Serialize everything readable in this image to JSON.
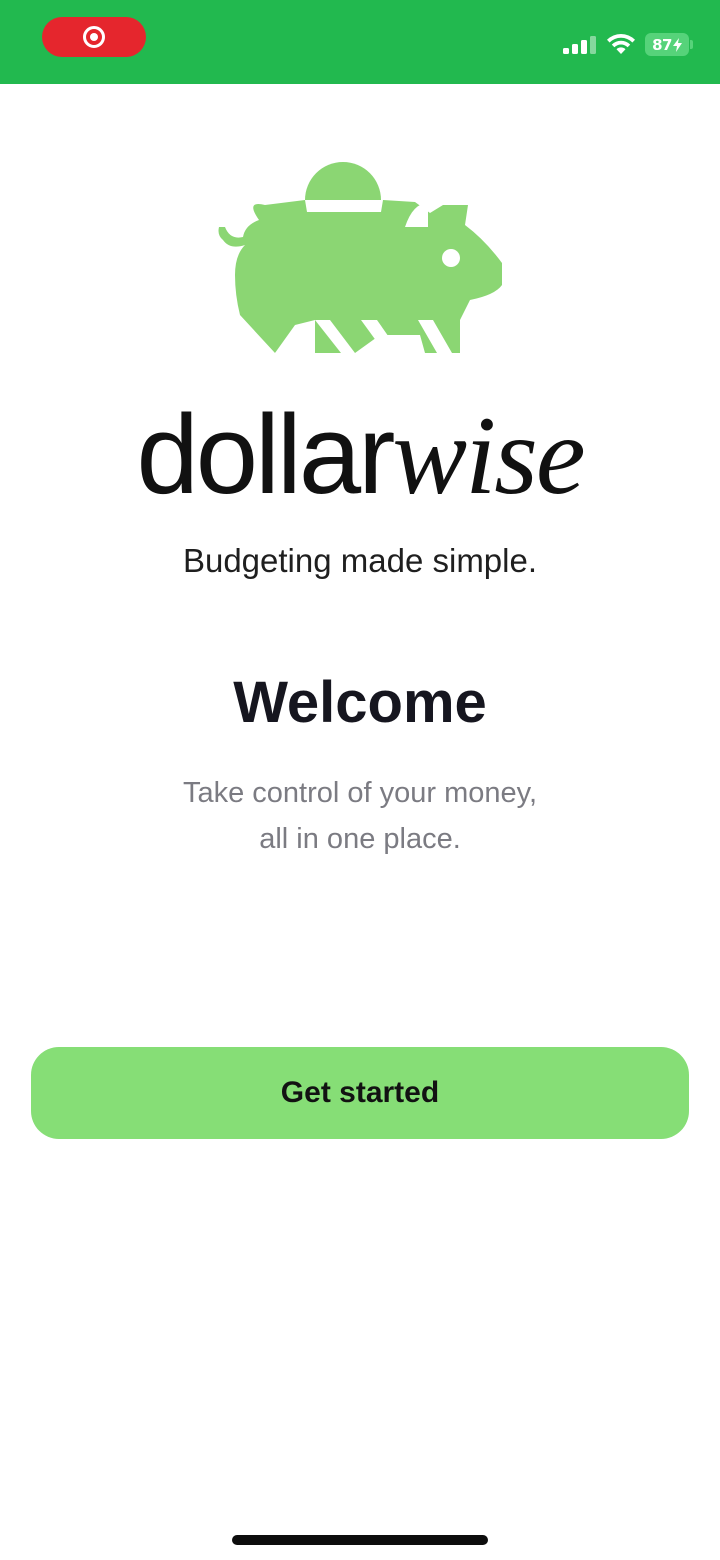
{
  "status_bar": {
    "battery_level": "87",
    "signal_icon": "cellular-signal-icon",
    "wifi_icon": "wifi-icon",
    "recording_icon": "screen-recording-icon",
    "background_color": "#22b94f"
  },
  "brand": {
    "logo_icon": "piggy-bank-icon",
    "name_part_1": "dollar",
    "name_part_2": "wise",
    "tagline": "Budgeting made simple.",
    "accent_color": "#86de76"
  },
  "welcome": {
    "title": "Welcome",
    "subtitle_line_1": "Take control of your money,",
    "subtitle_line_2": "all in one place."
  },
  "actions": {
    "primary_label": "Get started"
  }
}
